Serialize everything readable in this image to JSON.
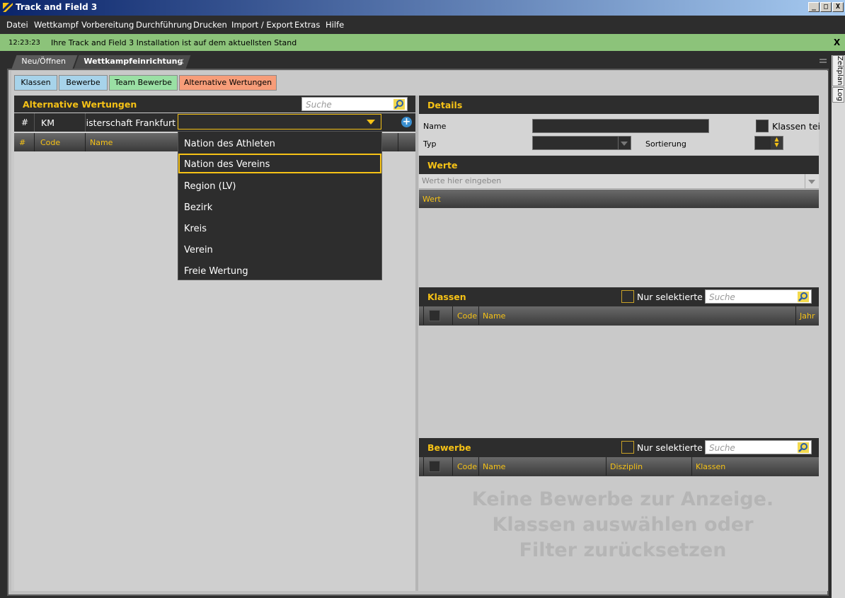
{
  "window": {
    "title": "Track and Field 3",
    "minimize": "_",
    "maximize": "□",
    "close": "X"
  },
  "menu": [
    "Datei",
    "Wettkampf",
    "Vorbereitung",
    "Durchführung",
    "Drucken",
    "Import / Export",
    "Extras",
    "Hilfe"
  ],
  "notification": {
    "time": "12:23:23",
    "message": "Ihre Track and Field 3 Installation ist auf dem aktuellsten Stand",
    "close": "X"
  },
  "doc_tabs": {
    "neu": "Neu/Öffnen",
    "wettkampf": "Wettkampfeinrichtung",
    "close": "✕"
  },
  "side_tabs": {
    "zeitplan": "Zeitplan",
    "log": "Log"
  },
  "sub_tabs": [
    "Klassen",
    "Bewerbe",
    "Team Bewerbe",
    "Alternative Wertungen"
  ],
  "colors": {
    "accent": "#f6c216",
    "notification": "#8cc37a",
    "tab_blue": "#a7d3ea",
    "tab_green": "#9ae0a4",
    "tab_orange": "#f79d79"
  },
  "left_panel": {
    "title": "Alternative Wertungen",
    "search_placeholder": "Suche",
    "row": {
      "hash": "#",
      "code": "KM",
      "name": "Vereinsmeisterschaft Frankfurt"
    },
    "columns": {
      "hash": "#",
      "code": "Code",
      "name": "Name"
    }
  },
  "dropdown": {
    "options": [
      "Nation des Athleten",
      "Nation des Vereins",
      "Region (LV)",
      "Bezirk",
      "Kreis",
      "Verein",
      "Freie Wertung"
    ],
    "selected": "Nation des Vereins"
  },
  "details": {
    "title": "Details",
    "name_label": "Name",
    "typ_label": "Typ",
    "sortierung_label": "Sortierung",
    "klassen_checkbox": "Klassen tei"
  },
  "werte": {
    "title": "Werte",
    "input_placeholder": "Werte hier eingeben",
    "column": "Wert"
  },
  "klassen": {
    "title": "Klassen",
    "filter": "Nur selektierte",
    "search_placeholder": "Suche",
    "columns": {
      "code": "Code",
      "name": "Name",
      "jahr": "Jahr"
    }
  },
  "bewerbe": {
    "title": "Bewerbe",
    "filter": "Nur selektierte",
    "search_placeholder": "Suche",
    "columns": {
      "code": "Code",
      "name": "Name",
      "disziplin": "Disziplin",
      "klassen": "Klassen"
    },
    "empty_line1": "Keine Bewerbe zur Anzeige.",
    "empty_line2": "Klassen auswählen oder",
    "empty_line3": "Filter zurücksetzen"
  }
}
